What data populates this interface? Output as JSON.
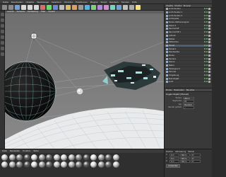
{
  "menubar": {
    "items": [
      "Datei",
      "Bearbeiten",
      "Objekte",
      "Werkzeuge",
      "Selektion",
      "Struktur",
      "Funktionen",
      "Plugins",
      "Skript",
      "Rendern",
      "Fenster",
      "Hilfe"
    ]
  },
  "toolbar": {
    "icons": [
      "undo-icon",
      "redo-icon",
      "live-selection-icon",
      "move-icon",
      "scale-icon",
      "rotate-icon",
      "x-axis-icon",
      "y-axis-icon",
      "z-axis-icon",
      "coord-system-icon",
      "render-view-icon",
      "render-picture-viewer-icon",
      "render-settings-icon",
      "cube-icon",
      "pen-icon",
      "subdivision-icon",
      "array-icon",
      "nurbs-icon",
      "deformer-icon",
      "scene-icon",
      "camera-icon",
      "light-icon"
    ]
  },
  "viewport": {
    "menu": [
      "Ansicht",
      "Kameras",
      "Darstellung",
      "Filter",
      "Fenster"
    ]
  },
  "object_manager": {
    "tabs": [
      "Objekte",
      "Struktur",
      "Browser"
    ],
    "rows": [
      {
        "name": "Licht-Fenster"
      },
      {
        "name": "Licht-Fenster 1"
      },
      {
        "name": "Licht-Fenster 2"
      },
      {
        "name": "Lichtquelle"
      },
      {
        "name": "Boden-Reflexionsgrad"
      },
      {
        "name": "Szene 2"
      },
      {
        "name": "Raumschiff"
      },
      {
        "name": "Raumschiff.1"
      },
      {
        "name": "Antrieb"
      },
      {
        "name": "Stütze"
      },
      {
        "name": "Hilfslichter"
      },
      {
        "name": "Planet"
      },
      {
        "name": "Planet.1"
      },
      {
        "name": "Staubwolke"
      },
      {
        "name": "Boden"
      },
      {
        "name": "Kamera"
      },
      {
        "name": "Sterne"
      },
      {
        "name": "Nebel"
      },
      {
        "name": "Hintergrund"
      },
      {
        "name": "Himmel"
      },
      {
        "name": "Umgebung"
      },
      {
        "name": "Null-Objekt"
      },
      {
        "name": "Licht"
      }
    ]
  },
  "attribute_manager": {
    "tabs": [
      "Modus",
      "Bearbeiten",
      "Benutzer"
    ],
    "title": "Kugel-Objekt [Planet]",
    "fields": [
      {
        "label": "Radius",
        "value": "400 m"
      },
      {
        "label": "Segmente",
        "value": "24"
      },
      {
        "label": "Typ",
        "value": "Standard"
      },
      {
        "label": "Render perfekt",
        "value": "✓"
      }
    ]
  },
  "material_manager": {
    "menu": [
      "Datei",
      "Bearbeiten",
      "Funktion",
      "Textur"
    ],
    "ball_count": 32
  },
  "coordinates": {
    "headers": [
      "Position",
      "Abmessung",
      "Winkel"
    ],
    "rows": [
      {
        "axis": "X",
        "pos": "0 m",
        "size": "800 m",
        "rot": "0°"
      },
      {
        "axis": "Y",
        "pos": "0 m",
        "size": "800 m",
        "rot": "0°"
      },
      {
        "axis": "Z",
        "pos": "0 m",
        "size": "800 m",
        "rot": "0°"
      }
    ],
    "apply_label": "Anwenden"
  }
}
